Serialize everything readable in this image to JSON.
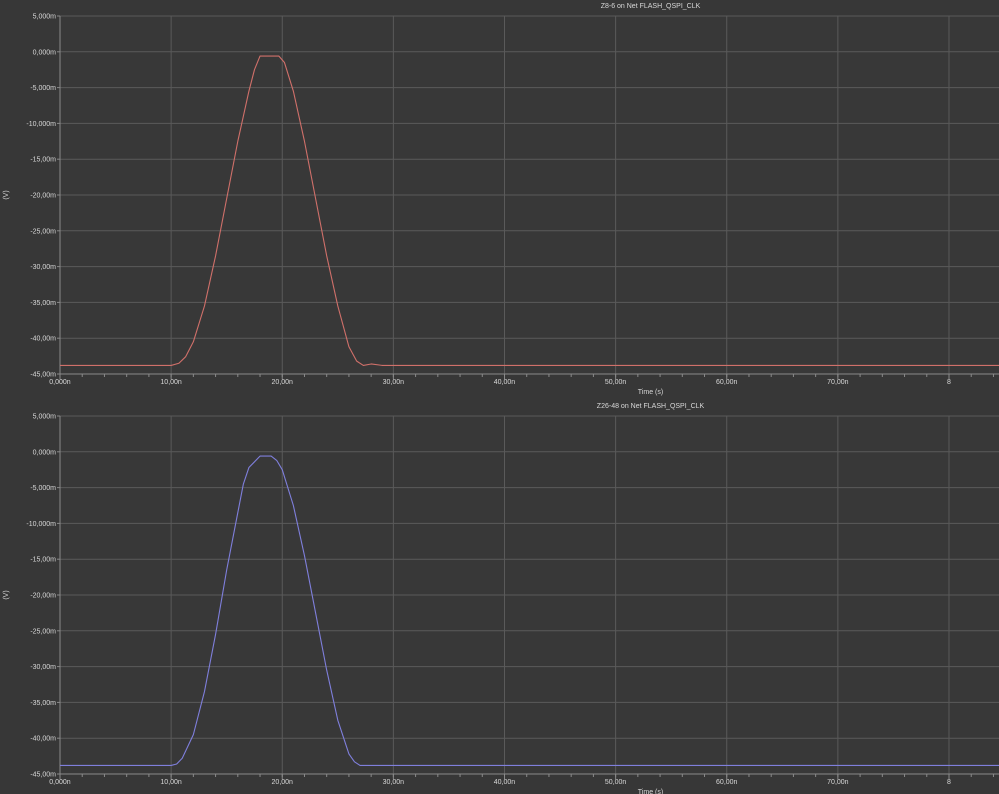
{
  "colors": {
    "background": "#373737",
    "grid": "#5a5a5a",
    "text": "#d8d8d8"
  },
  "chart_data": [
    {
      "type": "line",
      "title": "Z8-6 on Net FLASH_QSPI_CLK",
      "xlabel": "Time (s)",
      "ylabel": "(V)",
      "xlim": [
        0,
        8.45e-08
      ],
      "ylim": [
        -0.045,
        0.005
      ],
      "x_ticks": [
        0,
        1e-08,
        2e-08,
        3e-08,
        4e-08,
        5e-08,
        6e-08,
        7e-08,
        8e-08
      ],
      "x_tick_labels": [
        "0,000n",
        "10,00n",
        "20,00n",
        "30,00n",
        "40,00n",
        "50,00n",
        "60,00n",
        "70,00n",
        "8"
      ],
      "y_ticks": [
        0.005,
        0,
        -0.005,
        -0.01,
        -0.015,
        -0.02,
        -0.025,
        -0.03,
        -0.035,
        -0.04,
        -0.045
      ],
      "y_tick_labels": [
        "5,000m",
        "0,000m",
        "-5,000m",
        "-10,000m",
        "-15,00m",
        "-20,00m",
        "-25,00m",
        "-30,00m",
        "-35,00m",
        "-40,00m",
        "-45,00m"
      ],
      "grid": true,
      "legend": "none",
      "series": [
        {
          "color": "#d0706a",
          "x": [
            0,
            1e-08,
            1.07e-08,
            1.13e-08,
            1.2e-08,
            1.3e-08,
            1.4e-08,
            1.5e-08,
            1.6e-08,
            1.7e-08,
            1.75e-08,
            1.8e-08,
            1.9e-08,
            1.97e-08,
            2.02e-08,
            2.1e-08,
            2.2e-08,
            2.3e-08,
            2.4e-08,
            2.5e-08,
            2.6e-08,
            2.67e-08,
            2.73e-08,
            2.8e-08,
            2.9e-08,
            3e-08,
            8.45e-08
          ],
          "y": [
            -0.0438,
            -0.0438,
            -0.0435,
            -0.0426,
            -0.0405,
            -0.0355,
            -0.0285,
            -0.0205,
            -0.0125,
            -0.0055,
            -0.0025,
            -0.0006,
            -0.0006,
            -0.0006,
            -0.0015,
            -0.0055,
            -0.0125,
            -0.0205,
            -0.0285,
            -0.0355,
            -0.0412,
            -0.0432,
            -0.0438,
            -0.0436,
            -0.0438,
            -0.0438,
            -0.0438
          ]
        }
      ]
    },
    {
      "type": "line",
      "title": "Z26-48 on Net FLASH_QSPI_CLK",
      "xlabel": "Time (s)",
      "ylabel": "(V)",
      "xlim": [
        0,
        8.45e-08
      ],
      "ylim": [
        -0.045,
        0.005
      ],
      "x_ticks": [
        0,
        1e-08,
        2e-08,
        3e-08,
        4e-08,
        5e-08,
        6e-08,
        7e-08,
        8e-08
      ],
      "x_tick_labels": [
        "0,000n",
        "10,00n",
        "20,00n",
        "30,00n",
        "40,00n",
        "50,00n",
        "60,00n",
        "70,00n",
        "8"
      ],
      "y_ticks": [
        0.005,
        0,
        -0.005,
        -0.01,
        -0.015,
        -0.02,
        -0.025,
        -0.03,
        -0.035,
        -0.04,
        -0.045
      ],
      "y_tick_labels": [
        "5,000m",
        "0,000m",
        "-5,000m",
        "-10,000m",
        "-15,00m",
        "-20,00m",
        "-25,00m",
        "-30,00m",
        "-35,00m",
        "-40,00m",
        "-45,00m"
      ],
      "grid": true,
      "legend": "none",
      "series": [
        {
          "color": "#7f7fdc",
          "x": [
            0,
            1e-08,
            1.05e-08,
            1.1e-08,
            1.2e-08,
            1.3e-08,
            1.4e-08,
            1.5e-08,
            1.6e-08,
            1.65e-08,
            1.7e-08,
            1.8e-08,
            1.9e-08,
            1.95e-08,
            2e-08,
            2.1e-08,
            2.2e-08,
            2.3e-08,
            2.4e-08,
            2.5e-08,
            2.6e-08,
            2.65e-08,
            2.7e-08,
            2.8e-08,
            8.45e-08
          ],
          "y": [
            -0.0438,
            -0.0438,
            -0.0436,
            -0.0428,
            -0.0395,
            -0.0335,
            -0.0255,
            -0.0165,
            -0.0085,
            -0.0045,
            -0.0022,
            -0.0006,
            -0.0006,
            -0.0012,
            -0.0025,
            -0.0075,
            -0.0145,
            -0.0225,
            -0.0305,
            -0.0375,
            -0.0422,
            -0.0433,
            -0.0438,
            -0.0438,
            -0.0438
          ]
        }
      ]
    }
  ]
}
